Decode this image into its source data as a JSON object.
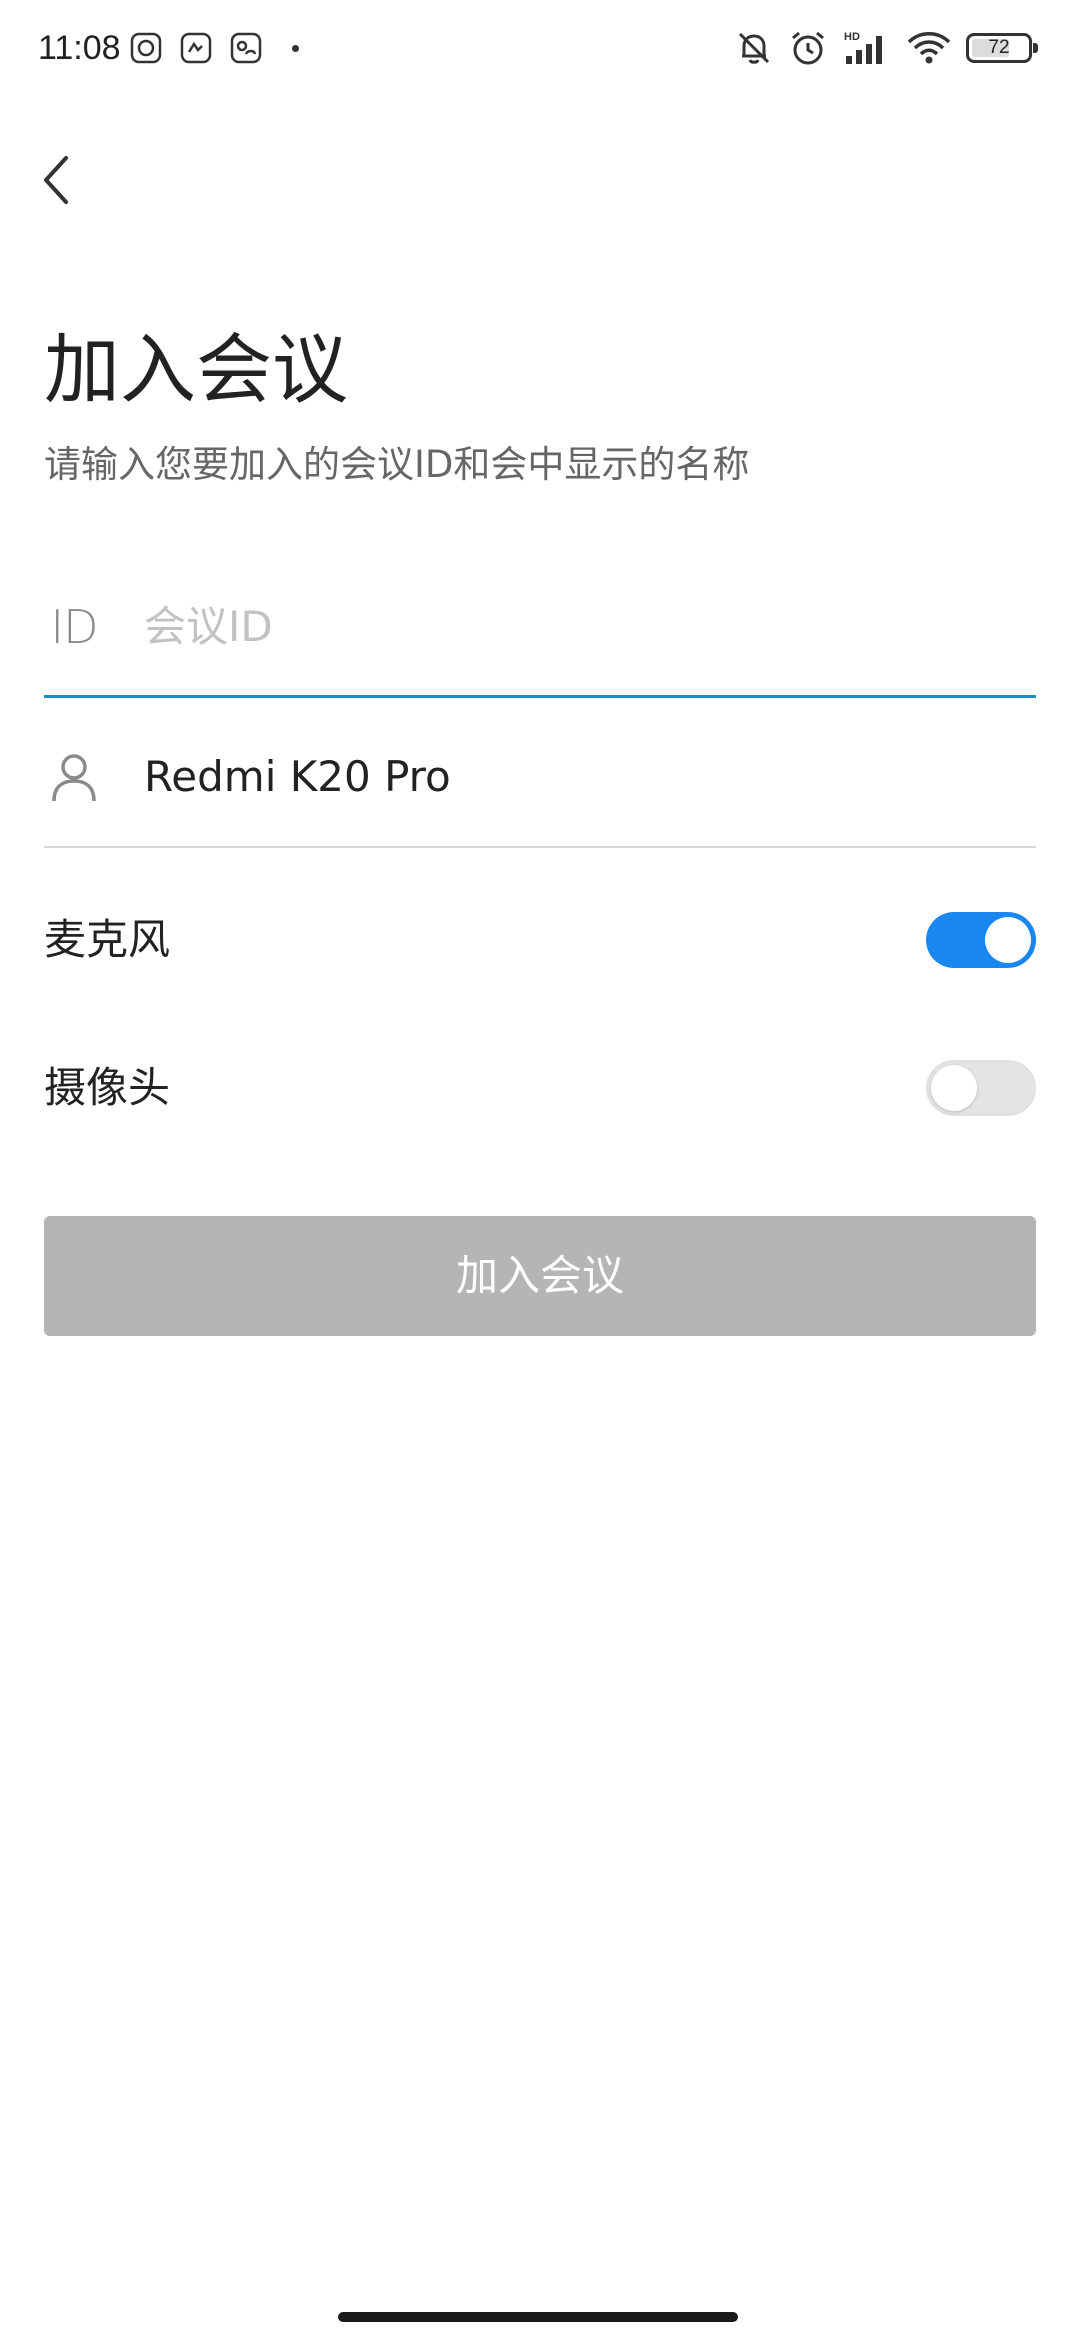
{
  "status_bar": {
    "time": "11:08",
    "battery": "72",
    "battery_level": 0.72,
    "icons": [
      "notification-app-icon",
      "notification-app-icon",
      "notification-app-icon",
      "mute-bell-icon",
      "alarm-icon",
      "signal-hd-icon",
      "wifi-icon",
      "battery-icon"
    ]
  },
  "page": {
    "title": "加入会议",
    "subtitle": "请输入您要加入的会议ID和会中显示的名称"
  },
  "form": {
    "meeting_id": {
      "icon_text": "ID",
      "placeholder": "会议ID",
      "value": ""
    },
    "display_name": {
      "value": "Redmi K20 Pro"
    },
    "microphone": {
      "label": "麦克风",
      "enabled": true
    },
    "camera": {
      "label": "摄像头",
      "enabled": false
    },
    "join_label": "加入会议"
  },
  "colors": {
    "accent": "#1a86f0",
    "underline_active": "#1a8ccf",
    "button_disabled": "#b5b5b5"
  }
}
